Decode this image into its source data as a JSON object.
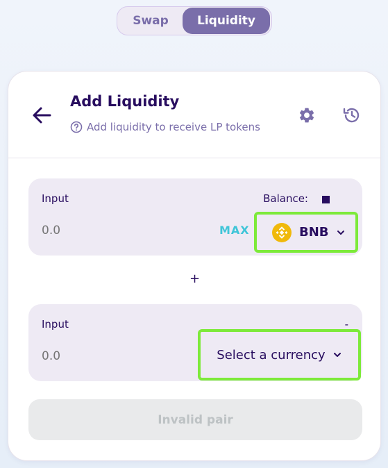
{
  "tabs": [
    {
      "label": "Swap",
      "active": false
    },
    {
      "label": "Liquidity",
      "active": true
    }
  ],
  "header": {
    "title": "Add Liquidity",
    "subtitle": "Add liquidity to receive LP tokens",
    "icons": [
      "arrow-back-icon",
      "help-icon",
      "gear-icon",
      "history-icon"
    ]
  },
  "input_a": {
    "label": "Input",
    "balance_label": "Balance: ",
    "amount": "0.0",
    "max_label": "MAX",
    "token": "BNB"
  },
  "plus": "+",
  "input_b": {
    "label": "Input",
    "dash": "-",
    "amount": "0.0",
    "token_placeholder": "Select a currency"
  },
  "action_button": {
    "label": "Invalid pair"
  },
  "colors": {
    "text": "#280d5f",
    "secondary": "#7a6eaa",
    "panel": "#eeeaf4",
    "max": "#3fc5d8",
    "highlight": "#7dea3a",
    "bnb": "#f0b90b",
    "disabled_bg": "#e9eaeb",
    "disabled_text": "#bdc2c4"
  }
}
